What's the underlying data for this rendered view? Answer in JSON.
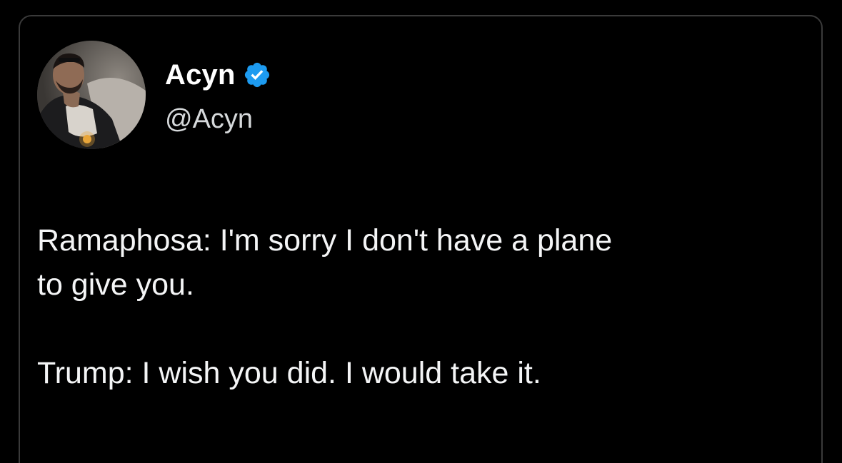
{
  "tweet": {
    "author": {
      "display_name": "Acyn",
      "handle": "@Acyn",
      "verified": true,
      "verified_badge_icon": "verified-badge-icon",
      "verified_color": "#1d9bf0",
      "avatar_icon": "avatar-photo"
    },
    "body": {
      "paragraph_1_line_1": "Ramaphosa: I'm sorry I don't have a plane",
      "paragraph_1_line_2": "to give you.",
      "paragraph_2_line_1": "Trump: I wish you did. I would take it."
    }
  },
  "colors": {
    "background": "#000000",
    "card_border": "#3a3a3a",
    "text_primary": "#ffffff",
    "text_secondary": "#d6d9db"
  }
}
